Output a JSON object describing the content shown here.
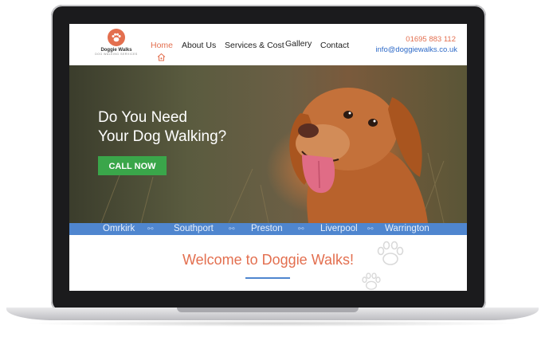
{
  "brand": {
    "name": "Doggie Walks",
    "tagline": "DOG WALKING SERVICES",
    "accent_color": "#e36f4f",
    "link_color": "#2f6bc8",
    "button_color": "#3aa64a",
    "strip_color": "#4f86cf"
  },
  "nav": {
    "items": [
      {
        "label": "Home",
        "active": true
      },
      {
        "label": "About Us",
        "active": false
      },
      {
        "label": "Services & Cost",
        "active": false
      },
      {
        "label": "Gallery",
        "active": false
      },
      {
        "label": "Contact",
        "active": false
      }
    ]
  },
  "contact": {
    "phone": "01695 883 112",
    "email": "info@doggiewalks.co.uk"
  },
  "hero": {
    "title_line1": "Do You Need",
    "title_line2": "Your Dog Walking?",
    "cta_label": "CALL NOW"
  },
  "locations": [
    "Omrkirk",
    "Southport",
    "Preston",
    "Liverpool",
    "Warrington"
  ],
  "welcome": {
    "title": "Welcome to Doggie Walks!"
  }
}
